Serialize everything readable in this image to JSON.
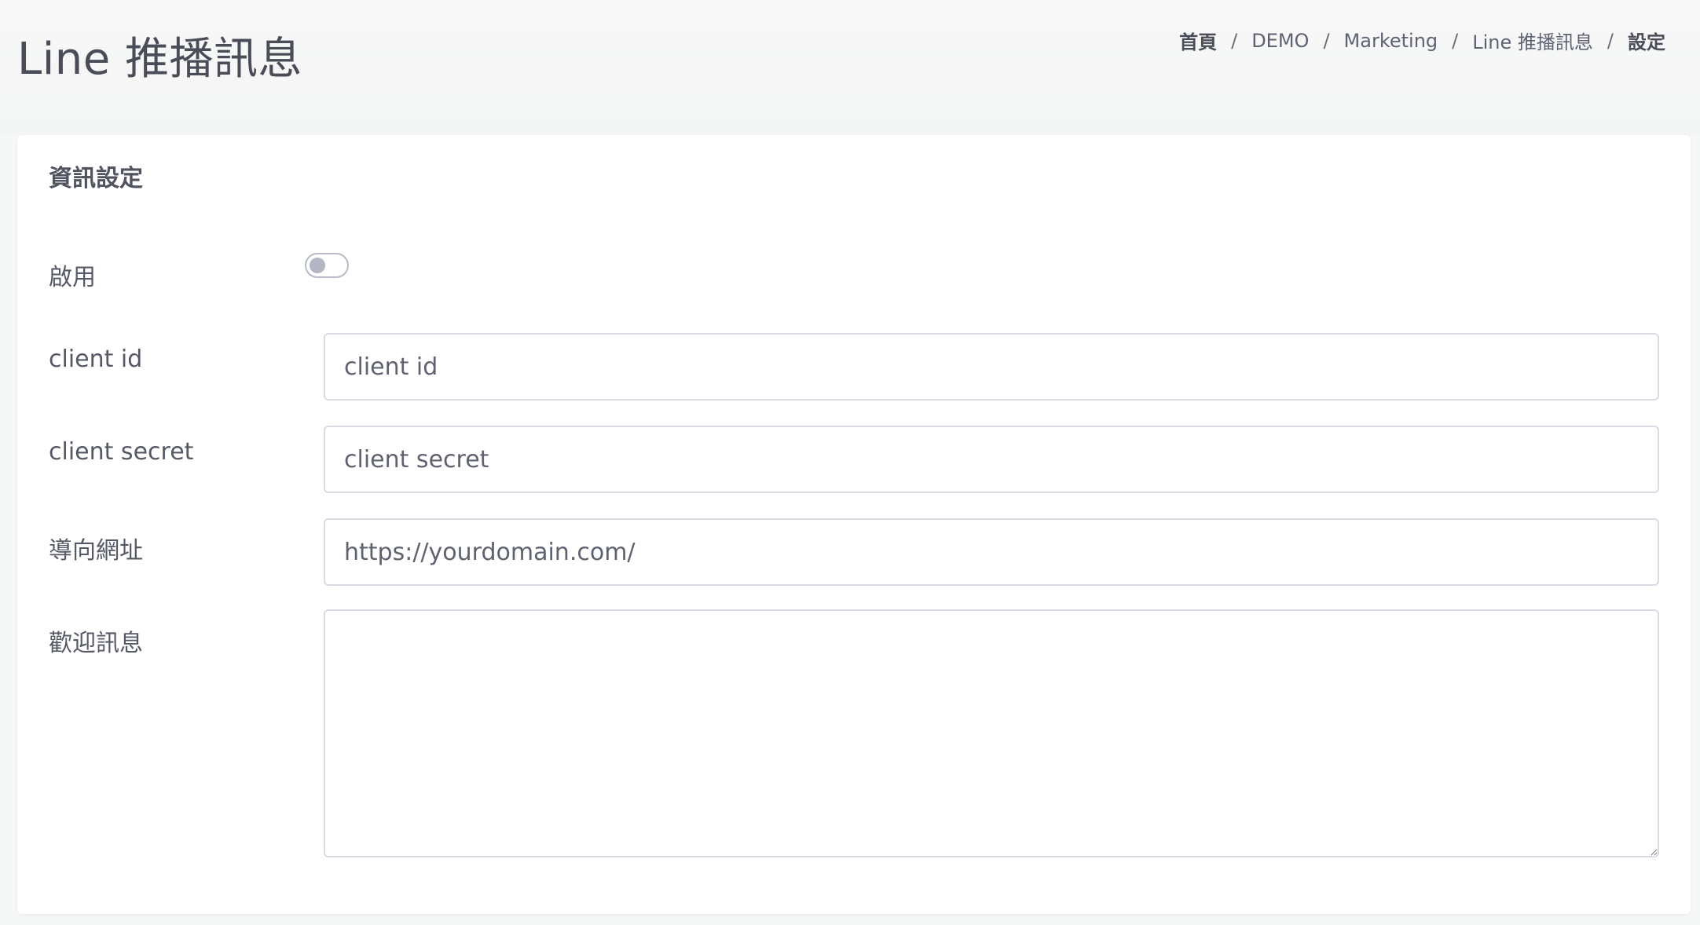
{
  "header": {
    "title": "Line 推播訊息",
    "breadcrumb": [
      {
        "label": "首頁"
      },
      {
        "label": "DEMO"
      },
      {
        "label": "Marketing"
      },
      {
        "label": "Line 推播訊息"
      },
      {
        "label": "設定"
      }
    ],
    "separator": "/"
  },
  "card": {
    "title": "資訊設定",
    "fields": {
      "enable": {
        "label": "啟用",
        "checked": false
      },
      "client_id": {
        "label": "client id",
        "value": "",
        "placeholder": "client id"
      },
      "client_secret": {
        "label": "client secret",
        "value": "",
        "placeholder": "client secret"
      },
      "redirect_url": {
        "label": "導向網址",
        "value": "",
        "placeholder": "https://yourdomain.com/"
      },
      "welcome_message": {
        "label": "歡迎訊息",
        "value": "",
        "placeholder": ""
      }
    }
  }
}
